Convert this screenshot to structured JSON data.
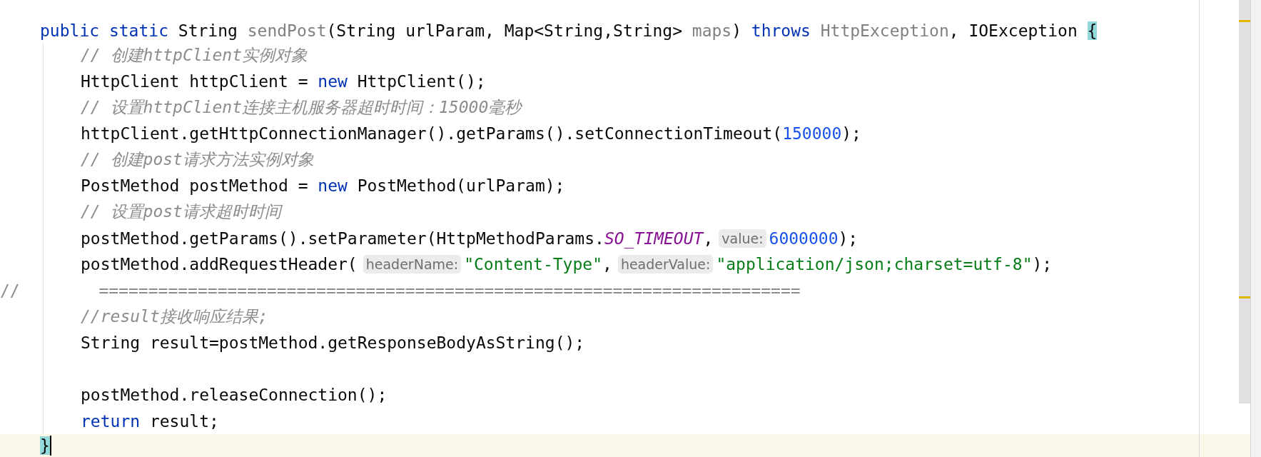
{
  "editor": {
    "signature": {
      "current": false,
      "tokens": [
        {
          "kind": "keyword",
          "text": "public static"
        },
        {
          "kind": "plain",
          "text": "String"
        },
        {
          "kind": "unused",
          "text": "sendPost"
        },
        {
          "kind": "plain",
          "text": "(String urlParam, Map<String,String>",
          "space": false
        },
        {
          "kind": "unused",
          "text": "maps"
        },
        {
          "kind": "plain",
          "text": ")",
          "space": false
        },
        {
          "kind": "keyword",
          "text": "throws"
        },
        {
          "kind": "unused",
          "text": "HttpException"
        },
        {
          "kind": "plain",
          "text": ", IOException",
          "space": false
        },
        {
          "kind": "brace_match",
          "text": "{"
        }
      ]
    },
    "body": [
      {
        "kind": "code",
        "tokens": [
          {
            "kind": "comment",
            "text": "// 创建httpClient实例对象"
          }
        ]
      },
      {
        "kind": "code",
        "tokens": [
          {
            "kind": "plain",
            "text": "HttpClient httpClient ="
          },
          {
            "kind": "keyword",
            "text": "new"
          },
          {
            "kind": "plain",
            "text": "HttpClient();"
          }
        ]
      },
      {
        "kind": "code",
        "tokens": [
          {
            "kind": "comment",
            "text": "// 设置httpClient连接主机服务器超时时间：15000毫秒"
          }
        ]
      },
      {
        "kind": "code",
        "tokens": [
          {
            "kind": "plain",
            "text": "httpClient.getHttpConnectionManager().getParams().setConnectionTimeout("
          },
          {
            "kind": "number",
            "text": "150000",
            "space": false
          },
          {
            "kind": "plain",
            "text": ");",
            "space": false
          }
        ]
      },
      {
        "kind": "code",
        "tokens": [
          {
            "kind": "comment",
            "text": "// 创建post请求方法实例对象"
          }
        ]
      },
      {
        "kind": "code",
        "tokens": [
          {
            "kind": "plain",
            "text": "PostMethod postMethod ="
          },
          {
            "kind": "keyword",
            "text": "new"
          },
          {
            "kind": "plain",
            "text": "PostMethod(urlParam);"
          }
        ]
      },
      {
        "kind": "code",
        "tokens": [
          {
            "kind": "comment",
            "text": "// 设置post请求超时时间"
          }
        ]
      },
      {
        "kind": "code",
        "tokens": [
          {
            "kind": "plain",
            "text": "postMethod.getParams().setParameter(HttpMethodParams."
          },
          {
            "kind": "static",
            "text": "SO_TIMEOUT",
            "space": false
          },
          {
            "kind": "plain",
            "text": ",",
            "space": false
          },
          {
            "kind": "hint",
            "text": "value:"
          },
          {
            "kind": "number",
            "text": "6000000",
            "space": false
          },
          {
            "kind": "plain",
            "text": ");",
            "space": false
          }
        ]
      },
      {
        "kind": "code",
        "tokens": [
          {
            "kind": "plain",
            "text": "postMethod.addRequestHeader("
          },
          {
            "kind": "hint",
            "text": "headerName:"
          },
          {
            "kind": "string",
            "text": "\"Content-Type\"",
            "space": false
          },
          {
            "kind": "plain",
            "text": ",",
            "space": false
          },
          {
            "kind": "hint",
            "text": "headerValue:"
          },
          {
            "kind": "string",
            "text": "\"application/json;charset=utf-8\"",
            "space": false
          },
          {
            "kind": "plain",
            "text": ");",
            "space": false
          }
        ]
      },
      {
        "kind": "commented_out",
        "tokens": [
          {
            "kind": "comment_plain",
            "text": "//        ======================================================================="
          }
        ]
      },
      {
        "kind": "code",
        "tokens": [
          {
            "kind": "comment",
            "text": "//result接收响应结果;"
          }
        ]
      },
      {
        "kind": "code",
        "tokens": [
          {
            "kind": "plain",
            "text": "String result=postMethod.getResponseBodyAsString();"
          }
        ]
      },
      {
        "kind": "blank"
      },
      {
        "kind": "code",
        "tokens": [
          {
            "kind": "plain",
            "text": "postMethod.releaseConnection();"
          }
        ]
      },
      {
        "kind": "code",
        "tokens": [
          {
            "kind": "keyword",
            "text": "return"
          },
          {
            "kind": "plain",
            "text": "result;"
          }
        ]
      }
    ],
    "closing": {
      "current": true,
      "tokens": [
        {
          "kind": "brace_match",
          "text": "}"
        }
      ]
    }
  }
}
